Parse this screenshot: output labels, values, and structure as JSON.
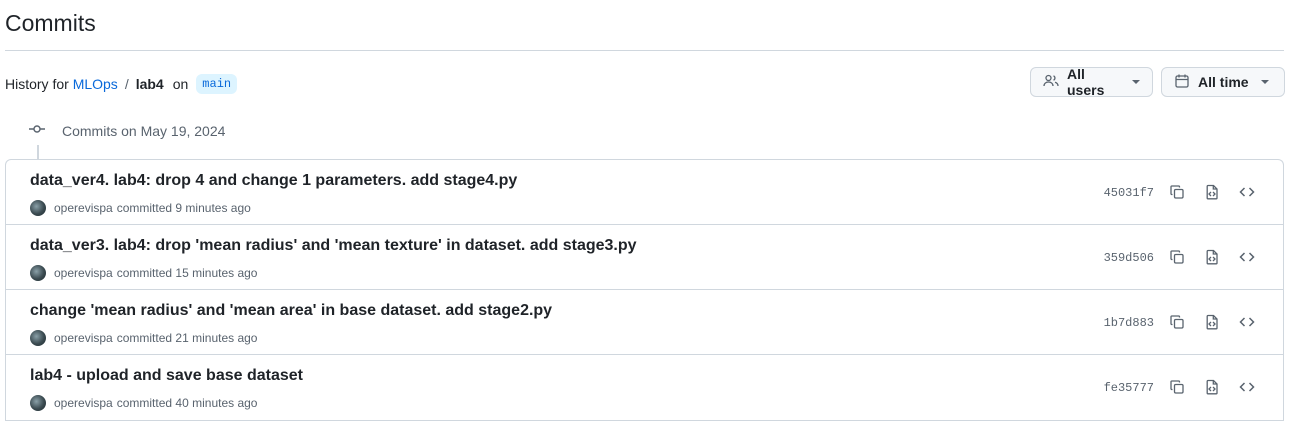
{
  "header": {
    "title": "Commits"
  },
  "history": {
    "prefix": "History for",
    "owner": "MLOps",
    "separator": "/",
    "repo": "lab4",
    "on": "on",
    "branch": "main"
  },
  "filters": {
    "users_label": "All users",
    "time_label": "All time"
  },
  "group": {
    "label": "Commits on May 19, 2024"
  },
  "commits": [
    {
      "message": "data_ver4. lab4: drop 4 and change 1 parameters. add stage4.py",
      "author": "operevispa",
      "action": "committed",
      "time": "9 minutes ago",
      "sha": "45031f7"
    },
    {
      "message": "data_ver3. lab4: drop 'mean radius' and 'mean texture' in dataset. add stage3.py",
      "author": "operevispa",
      "action": "committed",
      "time": "15 minutes ago",
      "sha": "359d506"
    },
    {
      "message": "change 'mean radius' and 'mean area' in base dataset. add stage2.py",
      "author": "operevispa",
      "action": "committed",
      "time": "21 minutes ago",
      "sha": "1b7d883"
    },
    {
      "message": "lab4 - upload and save base dataset",
      "author": "operevispa",
      "action": "committed",
      "time": "40 minutes ago",
      "sha": "fe35777"
    }
  ],
  "icons": {
    "users": "people-icon",
    "time": "calendar-icon",
    "group": "git-commit-icon",
    "copy": "copy-icon",
    "browse": "file-code-icon",
    "code": "code-icon"
  }
}
